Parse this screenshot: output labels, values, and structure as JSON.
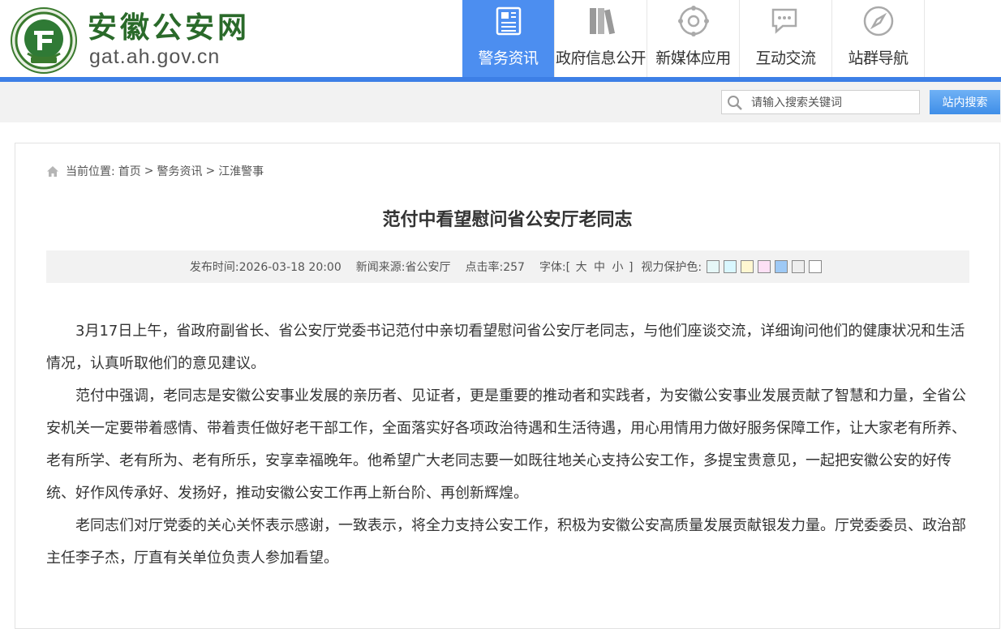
{
  "site": {
    "title": "安徽公安网",
    "domain": "gat.ah.gov.cn",
    "emblem_text": "安徽公安网"
  },
  "nav": {
    "items": [
      {
        "label": "警务资讯",
        "icon": "newspaper-icon",
        "active": true
      },
      {
        "label": "政府信息公开",
        "icon": "books-icon",
        "active": false
      },
      {
        "label": "新媒体应用",
        "icon": "network-icon",
        "active": false
      },
      {
        "label": "互动交流",
        "icon": "chat-icon",
        "active": false
      },
      {
        "label": "站群导航",
        "icon": "compass-icon",
        "active": false
      }
    ]
  },
  "search": {
    "placeholder": "请输入搜索关键词",
    "button_label": "站内搜索"
  },
  "breadcrumb": {
    "prefix": "当前位置:",
    "items": [
      "首页",
      "警务资讯",
      "江淮警事"
    ],
    "separator": ">"
  },
  "article": {
    "title": "范付中看望慰问省公安厅老同志",
    "publish_label": "发布时间:",
    "publish_time": "2026-03-18 20:00",
    "source_label": "新闻来源:",
    "source": "省公安厅",
    "clicks_label": "点击率:",
    "clicks": "257",
    "font_label": "字体:",
    "font_open": "[",
    "font_large": "大",
    "font_medium": "中",
    "font_small": "小",
    "font_close": "]",
    "eye_care_label": "视力保护色:",
    "eye_care_colors": [
      "#e6f7f7",
      "#d9f7ff",
      "#fff7d1",
      "#fde0f5",
      "#9ec9f5",
      "#eeeeee",
      "#ffffff"
    ],
    "paragraphs": [
      "3月17日上午，省政府副省长、省公安厅党委书记范付中亲切看望慰问省公安厅老同志，与他们座谈交流，详细询问他们的健康状况和生活情况，认真听取他们的意见建议。",
      "范付中强调，老同志是安徽公安事业发展的亲历者、见证者，更是重要的推动者和实践者，为安徽公安事业发展贡献了智慧和力量，全省公安机关一定要带着感情、带着责任做好老干部工作，全面落实好各项政治待遇和生活待遇，用心用情用力做好服务保障工作，让大家老有所养、老有所学、老有所为、老有所乐，安享幸福晚年。他希望广大老同志要一如既往地关心支持公安工作，多提宝贵意见，一起把安徽公安的好传统、好作风传承好、发扬好，推动安徽公安工作再上新台阶、再创新辉煌。",
      "老同志们对厅党委的关心关怀表示感谢，一致表示，将全力支持公安工作，积极为安徽公安高质量发展贡献银发力量。厅党委委员、政治部主任李子杰，厅直有关单位负责人参加看望。"
    ]
  },
  "colors": {
    "nav_active": "#4c8ef0",
    "accent_bar": "#3d7fe6",
    "logo_green": "#2a6a2a"
  }
}
